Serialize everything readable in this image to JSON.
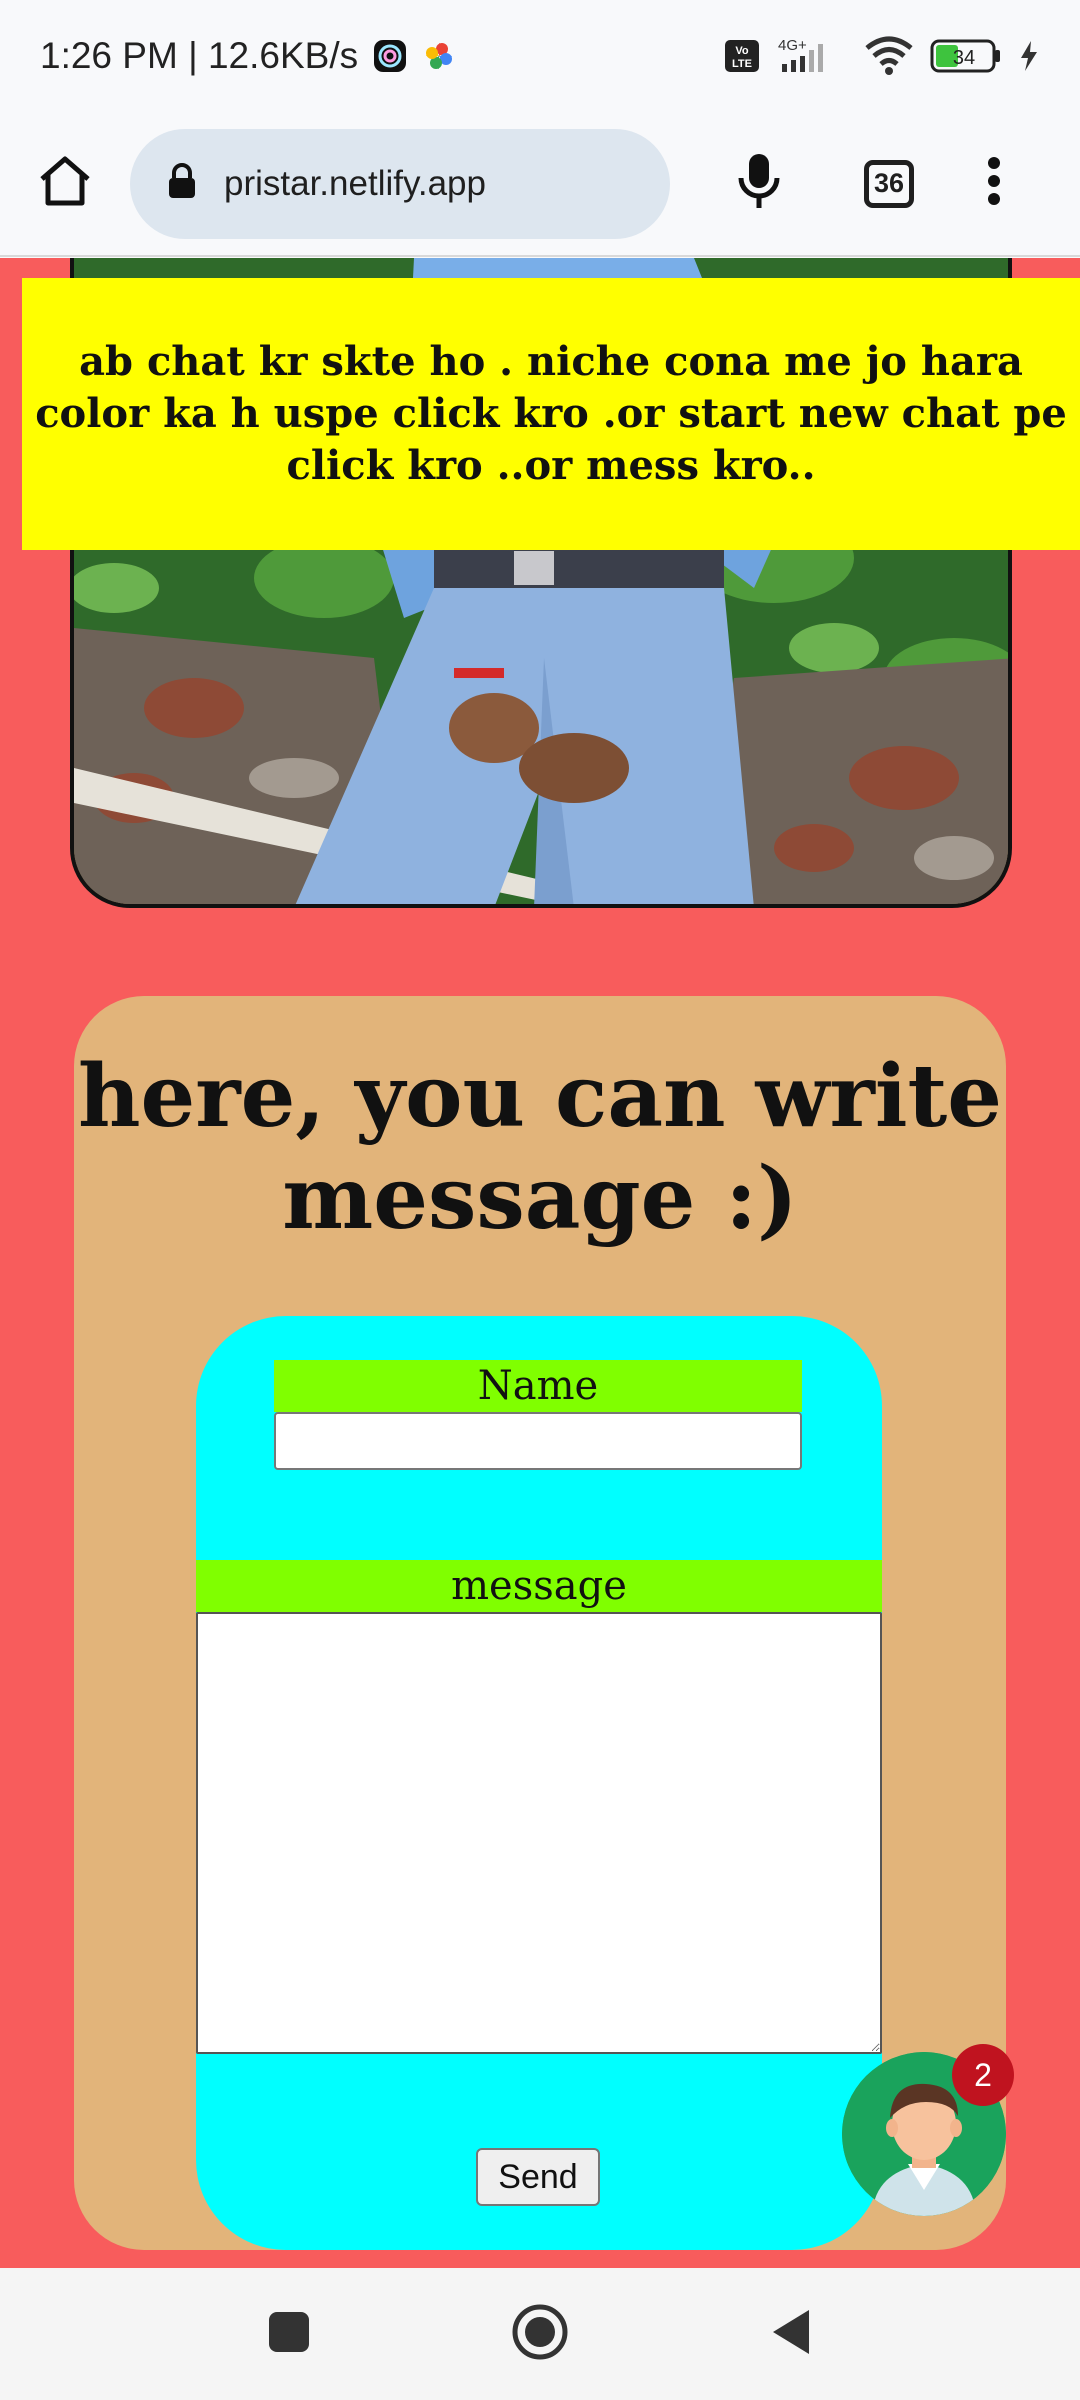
{
  "status_bar": {
    "time_speed": "1:26 PM | 12.6KB/s",
    "network_label": "4G+",
    "volte_label": "Vo LTE",
    "battery_level": "34"
  },
  "browser": {
    "url": "pristar.netlify.app",
    "tab_count": "36"
  },
  "page": {
    "banner_text": "ab chat kr skte ho . niche cona me jo hara color ka h uspe click kro .or start new chat pe click kro ..or mess kro..",
    "message_heading": "here, you can write message :)",
    "name_label": "Name",
    "name_value": "",
    "message_label": "message",
    "message_value": "",
    "send_label": "Send"
  },
  "chat_widget": {
    "badge_count": "2"
  },
  "colors": {
    "page_background": "#f85c5c",
    "banner": "#ffff00",
    "card": "#e2b47a",
    "form": "#00ffff",
    "label_bg": "#80ff00",
    "chat_fab": "#1aa35c",
    "badge": "#c0131f"
  },
  "icons": {
    "status": [
      "nfc-app-icon",
      "photos-pinwheel-icon",
      "volte-icon",
      "signal-icon",
      "wifi-icon",
      "battery-icon",
      "charging-icon"
    ],
    "toolbar": [
      "home-icon",
      "lock-icon",
      "mic-icon",
      "tabs-icon",
      "more-vert-icon"
    ],
    "nav": [
      "recents-square-icon",
      "home-circle-icon",
      "back-triangle-icon"
    ]
  }
}
